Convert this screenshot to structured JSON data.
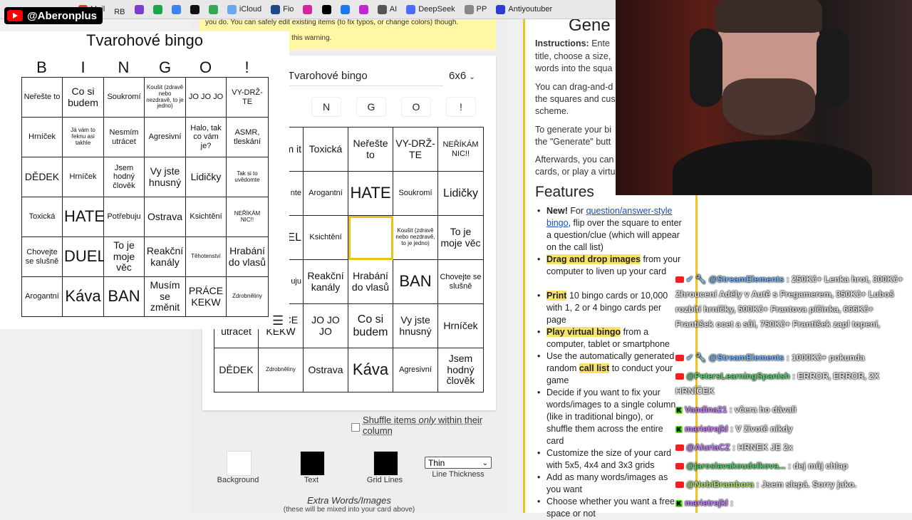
{
  "bookmarks": [
    "Mail",
    "RB",
    "iCloud",
    "Fio",
    "AI",
    "DeepSeek",
    "PP",
    "Antiyoutuber"
  ],
  "channel": {
    "handle": "@Aberonplus"
  },
  "warning": {
    "line1": "you do. You can safely edit existing items (to fix typos, or change colors) though.",
    "line2": "a game, you can disregard this warning."
  },
  "editor": {
    "title_value": "Tvarohové bingo",
    "size_value": "6x6",
    "header_letters": [
      "N",
      "G",
      "O",
      "!"
    ],
    "rows": [
      [
        "m\nit",
        "Toxická",
        "Neřešte to",
        "VY-DRŽ-TE",
        "NEŘÍKÁM NIC!!"
      ],
      [
        "to\nnte",
        "Arogantní",
        "HATE",
        "Soukromí",
        "Lidičky"
      ],
      [
        "EL",
        "Ksichtění",
        "",
        "Koušit (zdravě nebo nezdravě, to je jedno)",
        "To je moje věc"
      ],
      [
        "uju",
        "Reakční kanály",
        "Hrabání do vlasů",
        "BAN",
        "Chovejte se slušně"
      ],
      [
        "Nesmím utrácet",
        "PRÁCE KEKW",
        "JO JO JO",
        "Co si budem",
        "Vy jste hnusný",
        "Hrníček"
      ],
      [
        "DĚDEK",
        "Zdrobněliny",
        "Ostrava",
        "Káva",
        "Agresivní",
        "Jsem hodný člověk"
      ]
    ],
    "shuffle": {
      "pre": "Shuffle items ",
      "em": "only",
      "post": " within their column"
    },
    "colors": [
      {
        "label": "Background",
        "color": "#ffffff"
      },
      {
        "label": "Text",
        "color": "#000000"
      },
      {
        "label": "Grid Lines",
        "color": "#000000"
      }
    ],
    "thickness": {
      "value": "Thin",
      "label": "Line Thickness"
    },
    "extra_title": "Extra Words/Images",
    "extra_note": "(these will be mixed into your card above)"
  },
  "card": {
    "title": "Tvarohové bingo",
    "letters": [
      "B",
      "I",
      "N",
      "G",
      "O",
      "!"
    ],
    "rows": [
      [
        "Neřešte to",
        "Co si budem",
        "Soukromí",
        "Koušit (zdravě nebo nezdravě, to je jedno)",
        "JO JO JO",
        "VY-DRŽ-TE"
      ],
      [
        "Hrníček",
        "Já vám to řeknu asi takhle",
        "Nesmím utrácet",
        "Agresivní",
        "Halo, tak co vám je?",
        "ASMR, tleskání"
      ],
      [
        "DĚDEK",
        "Hrníček",
        "Jsem hodný člověk",
        "Vy jste hnusný",
        "Lidičky",
        "Tak si to uvědomte"
      ],
      [
        "Toxická",
        "HATE",
        "Potřebuju",
        "Ostrava",
        "Ksichtění",
        "NEŘÍKÁM NIC!!"
      ],
      [
        "Chovejte se slušně",
        "DUEL",
        "To je moje věc",
        "Reakční kanály",
        "Těhotenství",
        "Hrabání do vlasů"
      ],
      [
        "Arogantní",
        "Káva",
        "BAN",
        "Musím se změnit",
        "PRÁCE KEKW",
        "Zdrobněliny"
      ]
    ]
  },
  "site": {
    "heading": "Gene",
    "instructions_label": "Instructions:",
    "instructions": [
      "Ente",
      "title, choose a size,",
      "words into the squa"
    ],
    "para2": [
      "You can drag-and-d",
      "the squares and cus",
      "scheme."
    ],
    "para3": [
      "To generate your bi",
      "the \"Generate\" butt"
    ],
    "para4": [
      "Afterwards, you can",
      "cards, or play a virtu"
    ],
    "features_heading": "Features",
    "features": [
      {
        "bold": "New!",
        "pre": " For ",
        "link": "question/answer-style bingo",
        "post": ", flip over the square to enter a question/clue (which will appear on the call list)"
      },
      {
        "hl": "Drag and drop images",
        "post": " from your computer to liven up your card"
      },
      {
        "hl": "Print",
        "post": " 10 bingo cards or 10,000 with 1, 2 or 4 bingo cards per page"
      },
      {
        "hl": "Play virtual bingo",
        "post": " from a computer, tablet or smartphone"
      },
      {
        "pre": "Use the automatically generated random ",
        "hl": "call list",
        "post": " to conduct your game"
      },
      {
        "post": "Decide if you want to fix your words/images to a single column (like in traditional bingo), or shuffle them across the entire card"
      },
      {
        "post": "Customize the size of your card with 5x5, 4x4 and 3x3 grids"
      },
      {
        "post": "Add as many words/images as you want"
      },
      {
        "post": "Choose whether you want a free space or not"
      }
    ]
  },
  "chat": [
    {
      "user": "@StreamElements",
      "color": "#7ab8ff",
      "text": " : 250Kč+ Lenka hrot, 300Kč+ Zhroucení Adély v Autě s Fregamerem, 350Kč+ Luboš rozbití hrníčky, 500Kč+ Frantova pičinka, 666Kč+ František ocet a sůl, 750Kč+ František zapl topení,"
    },
    {
      "user": "@StreamElements",
      "color": "#7ab8ff",
      "text": " : 1000Kč+ pokunda"
    },
    {
      "user": "@PetersLearningSpanish",
      "color": "#5ad16b",
      "text": " : ERROR, ERROR, 2X HRNÍČEK"
    },
    {
      "user": "Vandina21",
      "color": "#c77dff",
      "text": " : včera ho dávali"
    },
    {
      "user": "marietrejkl",
      "color": "#c77dff",
      "text": " : V životě nikdy"
    },
    {
      "user": "@AluriaCZ",
      "color": "#c77dff",
      "text": " : HRNEK JE 2x"
    },
    {
      "user": "@jaroslavakoudelkova...",
      "color": "#5ad16b",
      "text": " : dej můj chlap"
    },
    {
      "user": "@NobiBrambora",
      "color": "#a3e26b",
      "text": " : Jsem slepá. Sorry jako."
    },
    {
      "user": "marietrejkl",
      "color": "#c77dff",
      "text": " :"
    }
  ]
}
